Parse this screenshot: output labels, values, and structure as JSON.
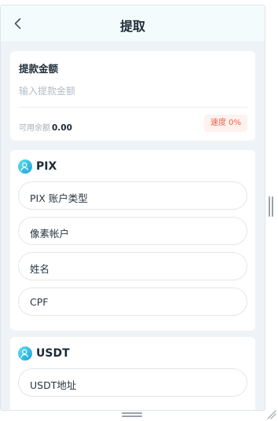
{
  "header": {
    "title": "提取",
    "back_icon": "chevron-left-icon"
  },
  "amount": {
    "label": "提款金额",
    "placeholder": "输入提款金额",
    "balance_label": "可用余额",
    "balance_value": "0.00",
    "rate_label": "速度 0%"
  },
  "pix": {
    "title": "PIX",
    "icon": "user-circle-icon",
    "fields": [
      "PIX 账户类型",
      "像素帐户",
      "姓名",
      "CPF"
    ]
  },
  "usdt": {
    "title": "USDT",
    "icon": "user-circle-icon",
    "fields": [
      "USDT地址"
    ]
  },
  "colors": {
    "header_bg": "#f4fbfd",
    "page_bg": "#eef3f7",
    "icon_gradient_start": "#45d3f0",
    "icon_gradient_end": "#1aa3d8",
    "badge_bg": "#fff1ee",
    "badge_text": "#e9614b"
  }
}
